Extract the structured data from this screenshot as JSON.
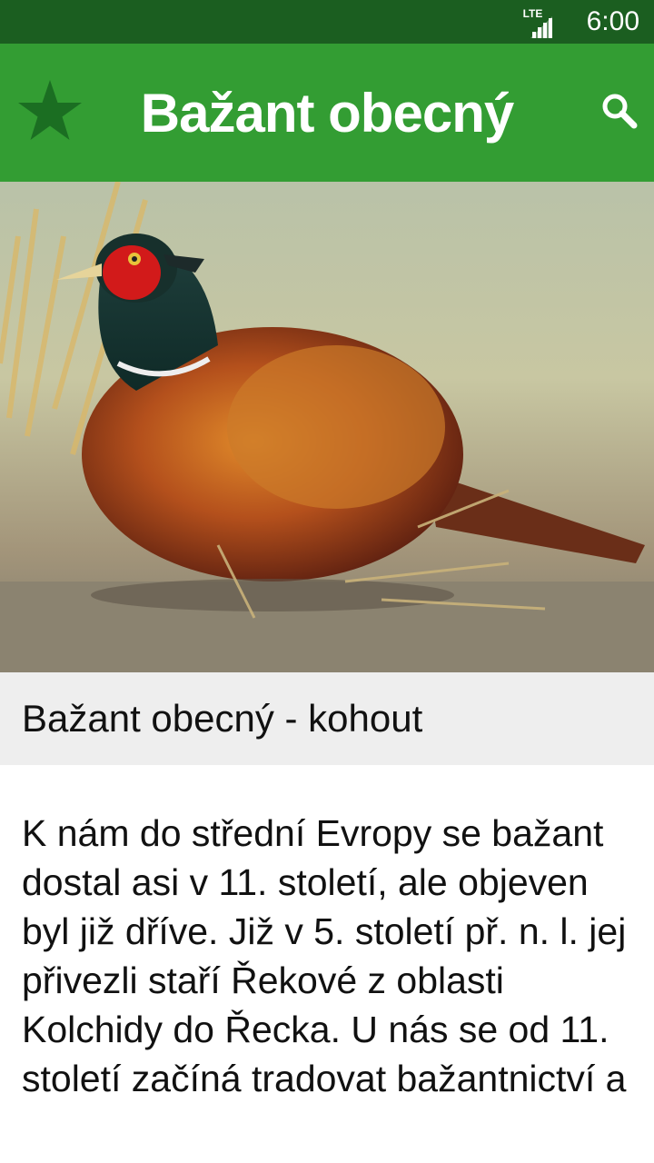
{
  "status_bar": {
    "network_label": "LTE",
    "time": "6:00"
  },
  "app_bar": {
    "title": "Bažant obecný",
    "left_icon": "star-icon",
    "right_icon": "search-icon",
    "accent_color": "#339d33",
    "status_color": "#1b5e20"
  },
  "photo": {
    "subject": "pheasant-photo"
  },
  "caption": "Bažant obecný - kohout",
  "article": {
    "text": "K nám do střední Evropy se bažant dostal asi v 11. století, ale objeven byl již dříve. Již v 5. století př. n. l. jej přivezli staří Řekové z oblasti Kolchidy do Řecka. U nás se od 11. století začíná tradovat bažantnictví a"
  }
}
